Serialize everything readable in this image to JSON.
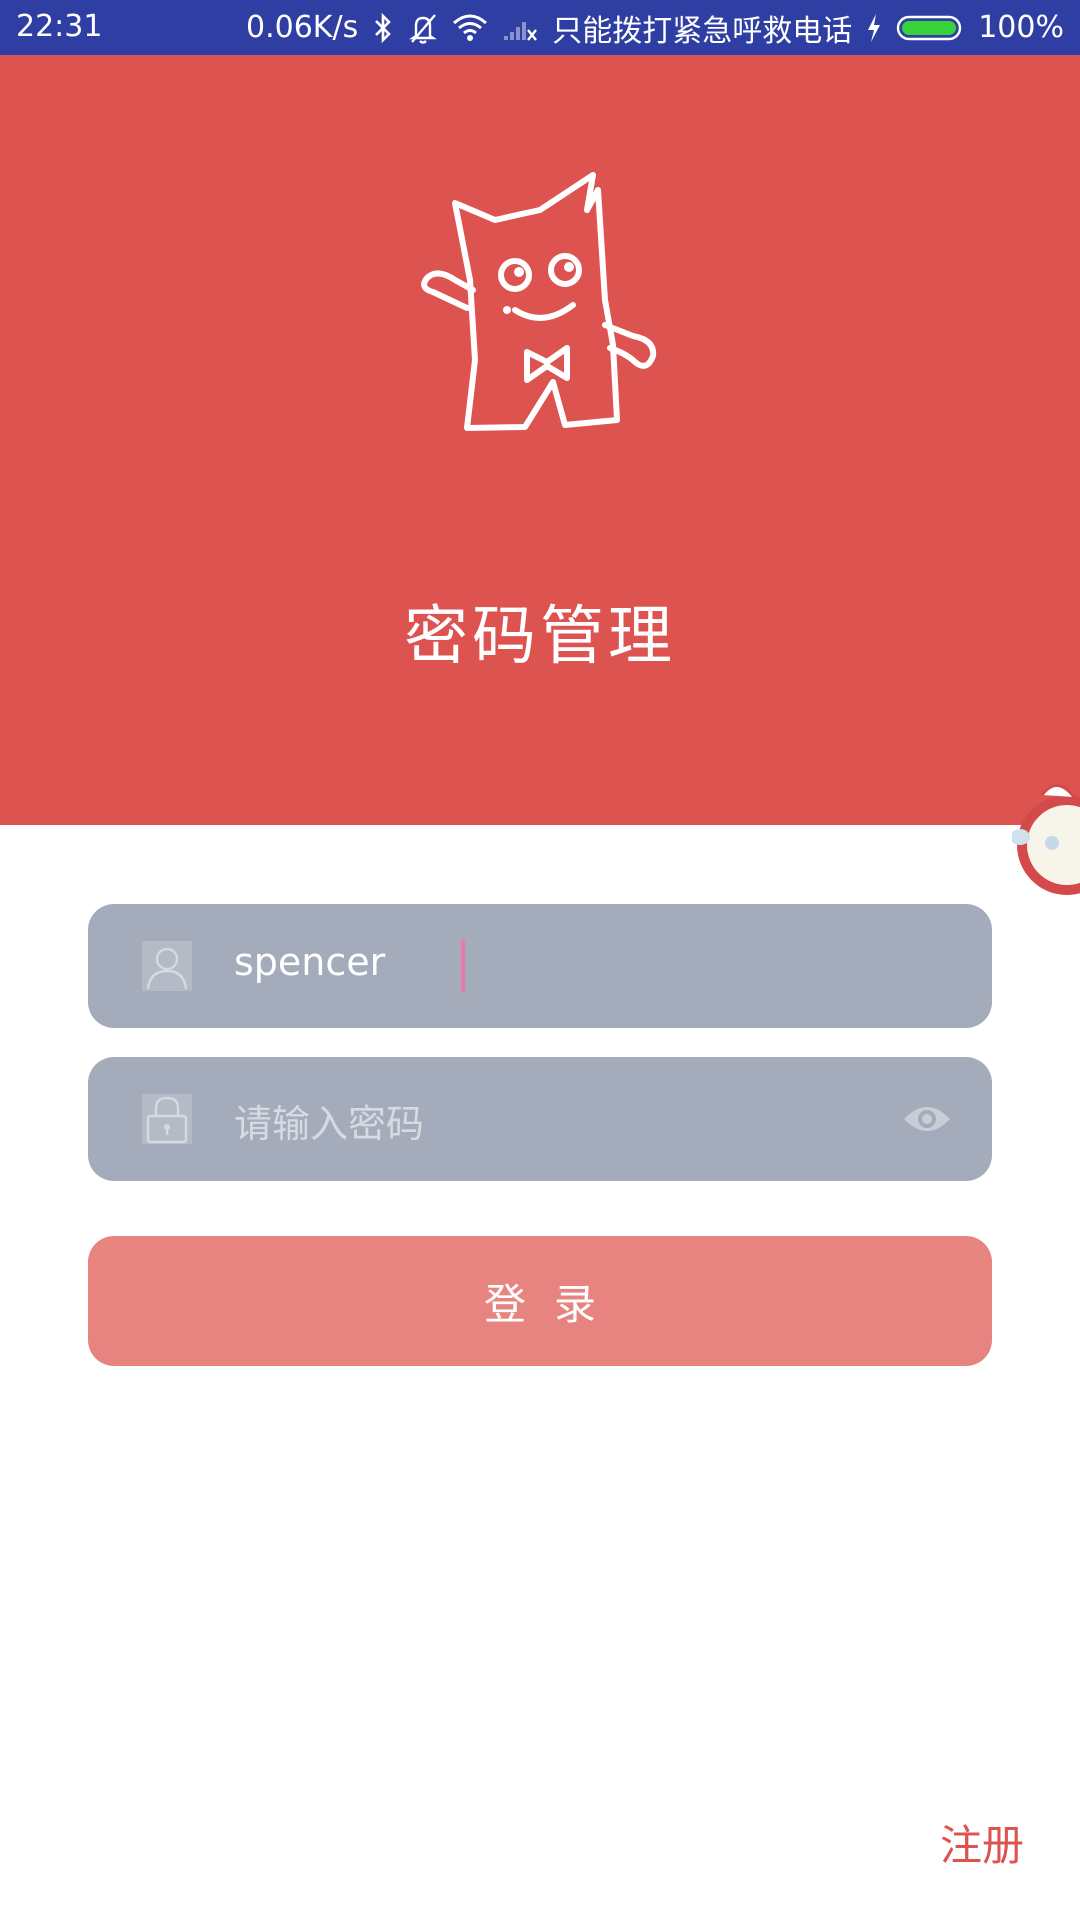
{
  "status_bar": {
    "time": "22:31",
    "net_speed": "0.06K/s",
    "carrier": "只能拨打紧急呼救电话",
    "battery": "100%",
    "icons": [
      "bluetooth-icon",
      "bell-off-icon",
      "wifi-icon",
      "signal-none-icon",
      "charging-icon",
      "battery-icon"
    ]
  },
  "header": {
    "title": "密码管理",
    "background_color": "#dd5350"
  },
  "form": {
    "username": {
      "value": "spencer",
      "icon": "user-icon"
    },
    "password": {
      "value": "",
      "placeholder": "请输入密码",
      "icon": "lock-icon",
      "toggle_icon": "eye-icon"
    },
    "login_label": "登录"
  },
  "footer": {
    "register_label": "注册"
  },
  "colors": {
    "status_bar": "#2f3ea3",
    "accent": "#dd5350",
    "field": "#a4abba",
    "login_button": "#e88480"
  }
}
